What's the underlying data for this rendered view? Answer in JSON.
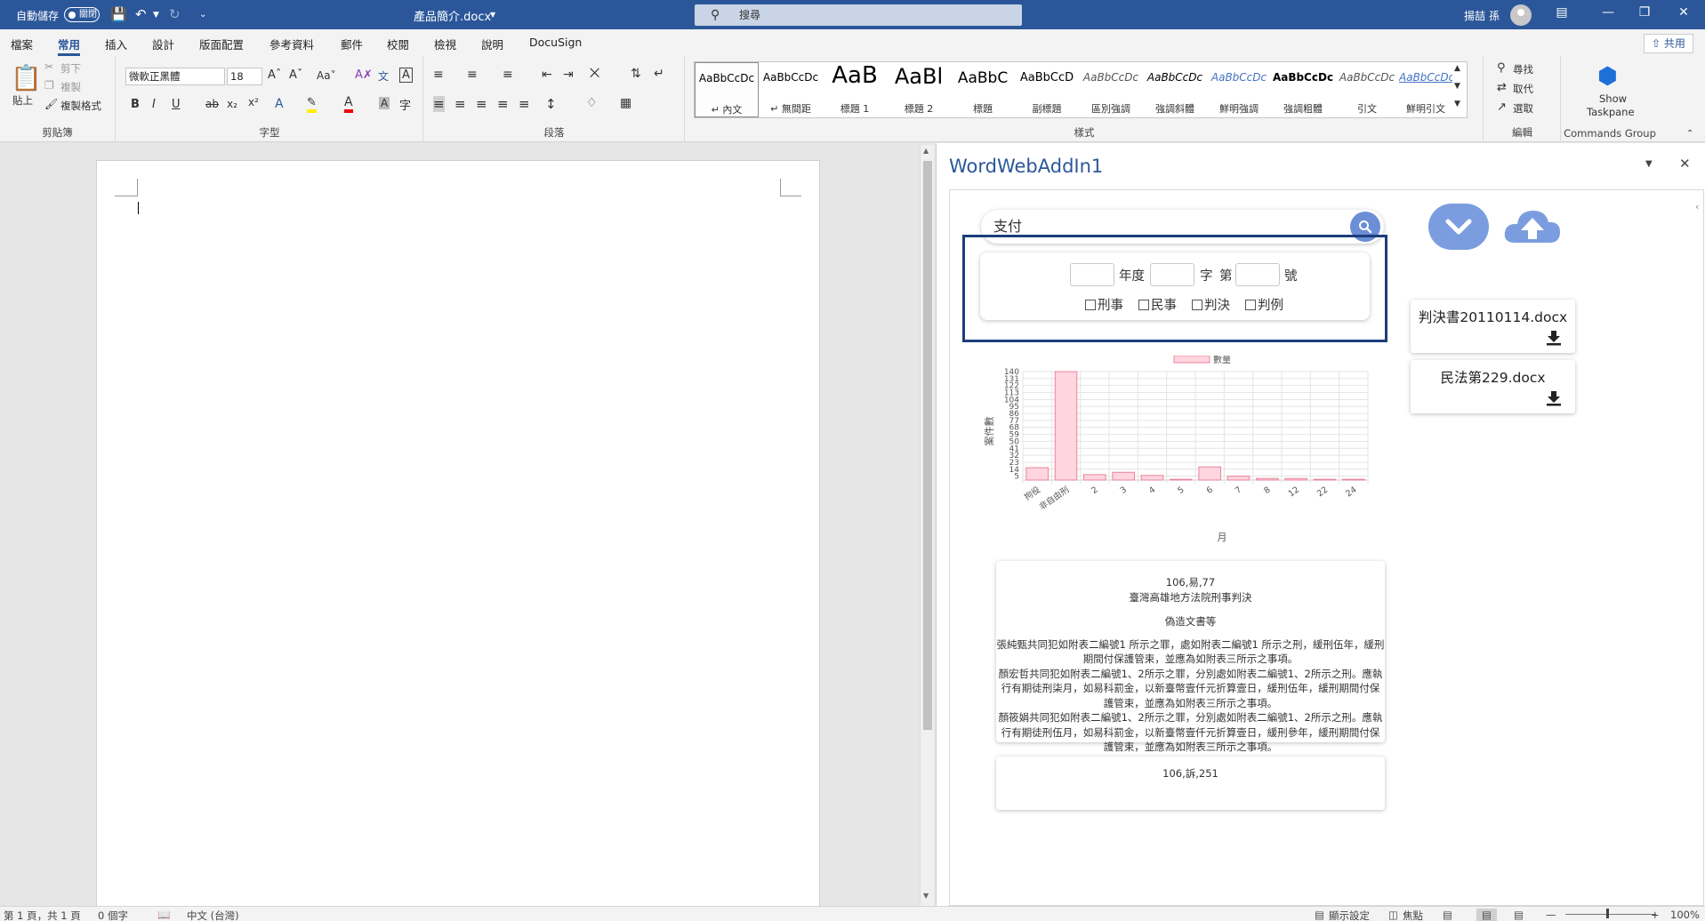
{
  "titlebar": {
    "autosave_label": "自動儲存",
    "autosave_state": "關閉",
    "doc_title": "產品簡介.docx",
    "search_placeholder": "搜尋",
    "user_name": "揚喆 孫"
  },
  "ribbon_tabs": [
    "檔案",
    "常用",
    "插入",
    "設計",
    "版面配置",
    "參考資料",
    "郵件",
    "校閱",
    "檢視",
    "說明",
    "DocuSign"
  ],
  "active_tab": "常用",
  "share_label": "共用",
  "clipboard": {
    "paste": "貼上",
    "cut": "剪下",
    "copy": "複製",
    "format_painter": "複製格式",
    "label": "剪貼簿"
  },
  "font": {
    "name": "微軟正黑體",
    "size": "18",
    "label": "字型"
  },
  "paragraph": {
    "label": "段落"
  },
  "styles": {
    "label": "樣式",
    "items": [
      {
        "preview": "AaBbCcDc",
        "name": "↵ 內文"
      },
      {
        "preview": "AaBbCcDc",
        "name": "↵ 無間距"
      },
      {
        "preview": "AaB",
        "name": "標題 1"
      },
      {
        "preview": "AaBl",
        "name": "標題 2"
      },
      {
        "preview": "AaBbC",
        "name": "標題"
      },
      {
        "preview": "AaBbCcD",
        "name": "副標題"
      },
      {
        "preview": "AaBbCcDc",
        "name": "區別強調"
      },
      {
        "preview": "AaBbCcDc",
        "name": "強調斜體"
      },
      {
        "preview": "AaBbCcDc",
        "name": "鮮明強調"
      },
      {
        "preview": "AaBbCcDc",
        "name": "強調粗體"
      },
      {
        "preview": "AaBbCcDc",
        "name": "引文"
      },
      {
        "preview": "AaBbCcDc",
        "name": "鮮明引文"
      }
    ]
  },
  "editing": {
    "find": "尋找",
    "replace": "取代",
    "select": "選取",
    "label": "編輯"
  },
  "commands": {
    "show_taskpane": "Show\nTaskpane",
    "show_line1": "Show",
    "show_line2": "Taskpane",
    "label": "Commands Group"
  },
  "pane": {
    "title": "WordWebAddIn1"
  },
  "addin": {
    "search_value": "支付",
    "filter": {
      "year_label": "年度",
      "word_label": "字",
      "no_prefix": "第",
      "no_suffix": "號",
      "checks": [
        "刑事",
        "民事",
        "判決",
        "判例"
      ]
    },
    "files": [
      "判決書20110114.docx",
      "民法第229.docx"
    ],
    "results": [
      {
        "id": "106,易,77",
        "court": "臺灣高雄地方法院刑事判決",
        "topic": "偽造文書等",
        "lines": [
          "張純甄共同犯如附表二編號1 所示之罪，處如附表二編號1 所示之刑，緩刑伍年，緩刑",
          "期間付保護管束，並應為如附表三所示之事項。",
          "顏宏哲共同犯如附表二編號1、2所示之罪，分別處如附表二編號1、2所示之刑。應執",
          "行有期徒刑柒月，如易科罰金，以新臺幣壹仟元折算壹日，緩刑伍年，緩刑期間付保",
          "護管束，並應為如附表三所示之事項。",
          "顏筱娟共同犯如附表二編號1、2所示之罪，分別處如附表二編號1、2所示之刑。應執",
          "行有期徒刑伍月，如易科罰金，以新臺幣壹仟元折算壹日，緩刑參年，緩刑期間付保",
          "護管束，並應為如附表三所示之事項。"
        ]
      },
      {
        "id": "106,訴,251"
      }
    ]
  },
  "chart_data": {
    "type": "bar",
    "legend": "數量",
    "xlabel": "月",
    "ylabel": "案件數",
    "categories": [
      "拘役",
      "非自由刑",
      "2",
      "3",
      "4",
      "5",
      "6",
      "7",
      "8",
      "12",
      "22",
      "24"
    ],
    "values": [
      16,
      140,
      7,
      10,
      6,
      1,
      17,
      5,
      2,
      2,
      1,
      1
    ],
    "yticks": [
      5,
      14,
      23,
      32,
      41,
      50,
      59,
      68,
      77,
      86,
      95,
      104,
      113,
      122,
      131,
      140
    ],
    "ylim": [
      0,
      140
    ],
    "grid": true,
    "legend_position": "top",
    "bar_color": "#ffd5df",
    "bar_stroke": "#e8849c"
  },
  "status": {
    "page": "第 1 頁，共 1 頁",
    "words": "0 個字",
    "lang": "中文 (台灣)",
    "display": "顯示設定",
    "focus": "焦點",
    "zoom": "100%"
  }
}
